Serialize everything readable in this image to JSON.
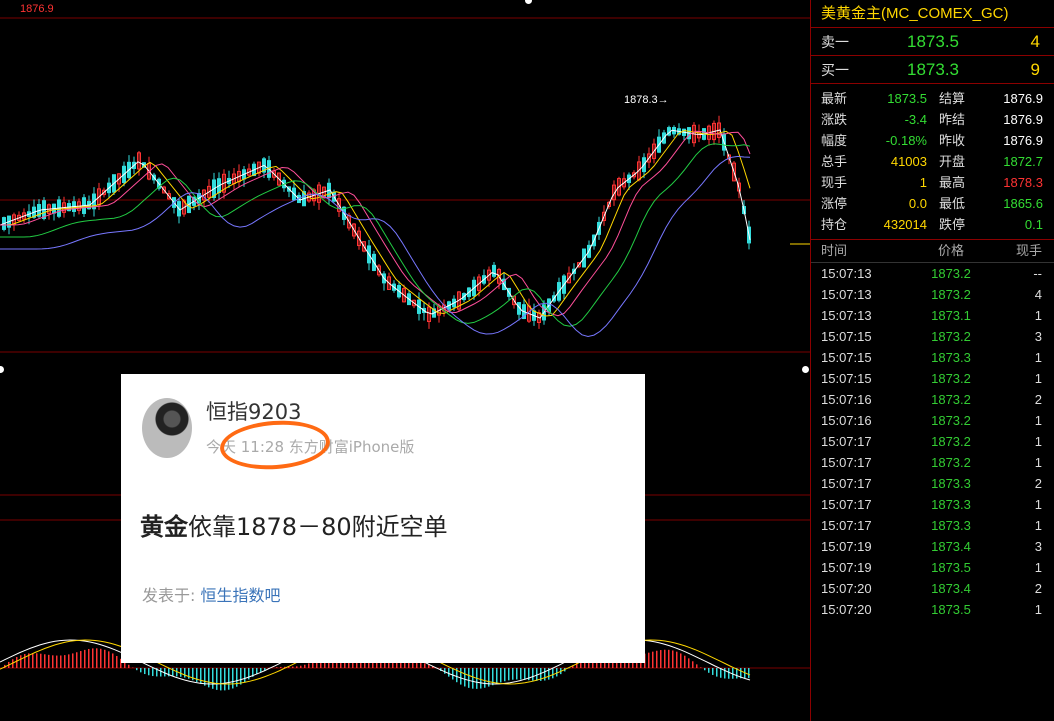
{
  "chart": {
    "top_price_label": "1876.9",
    "high_marker": "1878.3",
    "colors": {
      "up": "#ff3333",
      "down": "#33dddd",
      "ma1": "#ffffff",
      "ma2": "#ffd700",
      "ma3": "#ff4f9a",
      "ma4": "#22cc44",
      "ma5": "#7777ff"
    }
  },
  "panel": {
    "title": "美黄金主(MC_COMEX_GC)",
    "ask": {
      "label": "卖一",
      "price": "1873.5",
      "volume": "4"
    },
    "bid": {
      "label": "买一",
      "price": "1873.3",
      "volume": "9"
    },
    "stats": [
      {
        "l1": "最新",
        "v1": "1873.5",
        "l2": "结算",
        "v2": "1876.9",
        "c2": "#ffffff"
      },
      {
        "l1": "涨跌",
        "v1": "-3.4",
        "l2": "昨结",
        "v2": "1876.9",
        "c2": "#ffffff"
      },
      {
        "l1": "幅度",
        "v1": "-0.18%",
        "l2": "昨收",
        "v2": "1876.9",
        "c2": "#ffffff"
      },
      {
        "l1": "总手",
        "v1": "41003",
        "l2": "开盘",
        "v2": "1872.7",
        "c2": "#33dd33",
        "c1": "#ffd700"
      },
      {
        "l1": "现手",
        "v1": "1",
        "l2": "最高",
        "v2": "1878.3",
        "c2": "#ff3333",
        "c1": "#ffd700"
      },
      {
        "l1": "涨停",
        "v1": "0.0",
        "l2": "最低",
        "v2": "1865.6",
        "c2": "#33dd33",
        "c1": "#ffd700"
      },
      {
        "l1": "持仓",
        "v1": "432014",
        "l2": "跌停",
        "v2": "0.1",
        "c2": "#33dd33",
        "c1": "#ffd700"
      }
    ],
    "ticks_header": {
      "time": "时间",
      "price": "价格",
      "volume": "现手"
    },
    "ticks": [
      {
        "time": "15:07:13",
        "price": "1873.2",
        "volume": "--"
      },
      {
        "time": "15:07:13",
        "price": "1873.2",
        "volume": "4"
      },
      {
        "time": "15:07:13",
        "price": "1873.1",
        "volume": "1"
      },
      {
        "time": "15:07:15",
        "price": "1873.2",
        "volume": "3"
      },
      {
        "time": "15:07:15",
        "price": "1873.3",
        "volume": "1"
      },
      {
        "time": "15:07:15",
        "price": "1873.2",
        "volume": "1"
      },
      {
        "time": "15:07:16",
        "price": "1873.2",
        "volume": "2"
      },
      {
        "time": "15:07:16",
        "price": "1873.2",
        "volume": "1"
      },
      {
        "time": "15:07:17",
        "price": "1873.2",
        "volume": "1"
      },
      {
        "time": "15:07:17",
        "price": "1873.2",
        "volume": "1"
      },
      {
        "time": "15:07:17",
        "price": "1873.3",
        "volume": "2"
      },
      {
        "time": "15:07:17",
        "price": "1873.3",
        "volume": "1"
      },
      {
        "time": "15:07:17",
        "price": "1873.3",
        "volume": "1"
      },
      {
        "time": "15:07:19",
        "price": "1873.4",
        "volume": "3"
      },
      {
        "time": "15:07:19",
        "price": "1873.5",
        "volume": "1"
      },
      {
        "time": "15:07:20",
        "price": "1873.4",
        "volume": "2"
      },
      {
        "time": "15:07:20",
        "price": "1873.5",
        "volume": "1"
      }
    ]
  },
  "post": {
    "username": "恒指9203",
    "meta": "今天 11:28 东方财富iPhone版",
    "body_bold": "黄金",
    "body_text": "依靠1878－80附近空单",
    "posted_label": "发表于:",
    "forum": "恒生指数吧"
  }
}
